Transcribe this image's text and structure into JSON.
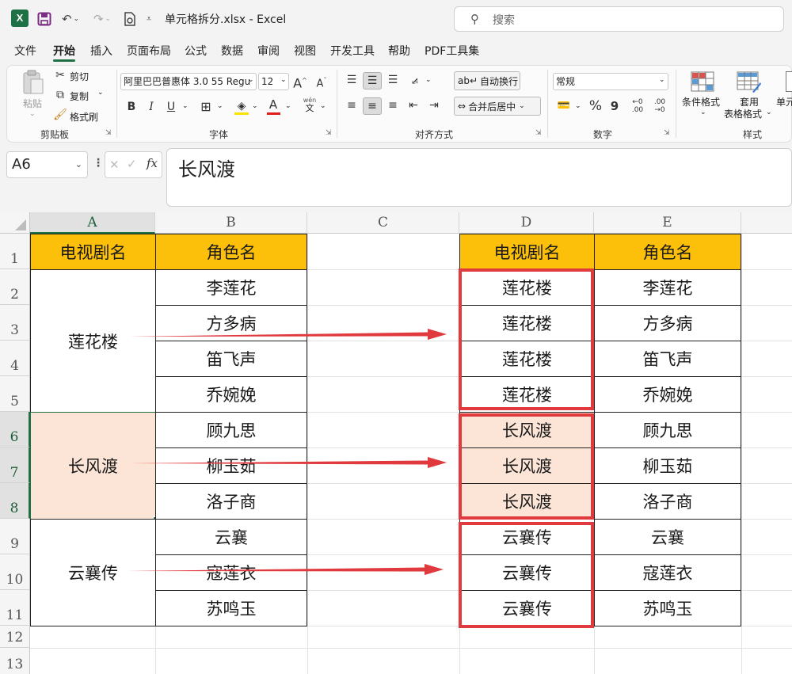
{
  "titlebar": {
    "title": "单元格拆分.xlsx  -  Excel",
    "search_placeholder": "搜索",
    "icons": [
      "excel-logo-icon",
      "save-icon",
      "undo-icon",
      "redo-icon",
      "print-preview-icon",
      "customize-toolbar-icon"
    ]
  },
  "menu": [
    "文件",
    "开始",
    "插入",
    "页面布局",
    "公式",
    "数据",
    "审阅",
    "视图",
    "开发工具",
    "帮助",
    "PDF工具集"
  ],
  "ribbon": {
    "clipboard": {
      "paste": "粘贴",
      "cut": "剪切",
      "copy": "复制",
      "format_painter": "格式刷",
      "label": "剪贴板"
    },
    "font": {
      "font_name": "阿里巴巴普惠体 3.0 55 Regu",
      "font_size": "12",
      "grow": "A",
      "shrink": "A",
      "bold": "B",
      "italic": "I",
      "underline": "U",
      "font_color": "A",
      "wen": "wén",
      "wen_char": "文",
      "label": "字体"
    },
    "alignment": {
      "wrap_text": "自动换行",
      "merge_center": "合并后居中",
      "label": "对齐方式"
    },
    "number": {
      "format": "常规",
      "percent": "%",
      "comma": "9",
      "inc_decimal": "←0\n.00",
      "dec_decimal": ".00\n→0",
      "label": "数字"
    },
    "styles": {
      "conditional": "条件格式",
      "table_line1": "套用",
      "table_line2": "表格格式",
      "cell_styles": "单元",
      "label": "样式"
    }
  },
  "formula_bar": {
    "name_box": "A6",
    "fx": "fx",
    "value": "长风渡"
  },
  "columns": [
    "A",
    "B",
    "C",
    "D",
    "E"
  ],
  "rows": [
    "1",
    "2",
    "3",
    "4",
    "5",
    "6",
    "7",
    "8",
    "9",
    "10",
    "11",
    "12",
    "13"
  ],
  "table_left": {
    "headers": [
      "电视剧名",
      "角色名"
    ],
    "groups": [
      {
        "drama": "莲花楼",
        "roles": [
          "李莲花",
          "方多病",
          "笛飞声",
          "乔婉娩"
        ]
      },
      {
        "drama": "长风渡",
        "roles": [
          "顾九思",
          "柳玉茹",
          "洛子商"
        ]
      },
      {
        "drama": "云襄传",
        "roles": [
          "云襄",
          "寇莲衣",
          "苏鸣玉"
        ]
      }
    ]
  },
  "table_right": {
    "headers": [
      "电视剧名",
      "角色名"
    ],
    "rows": [
      [
        "莲花楼",
        "李莲花"
      ],
      [
        "莲花楼",
        "方多病"
      ],
      [
        "莲花楼",
        "笛飞声"
      ],
      [
        "莲花楼",
        "乔婉娩"
      ],
      [
        "长风渡",
        "顾九思"
      ],
      [
        "长风渡",
        "柳玉茹"
      ],
      [
        "长风渡",
        "洛子商"
      ],
      [
        "云襄传",
        "云襄"
      ],
      [
        "云襄传",
        "寇莲衣"
      ],
      [
        "云襄传",
        "苏鸣玉"
      ]
    ]
  },
  "colors": {
    "header_fill": "#FCC00A",
    "highlight_fill": "#FCE4D6",
    "annotation_red": "#E0393E",
    "excel_green": "#1E7145"
  }
}
